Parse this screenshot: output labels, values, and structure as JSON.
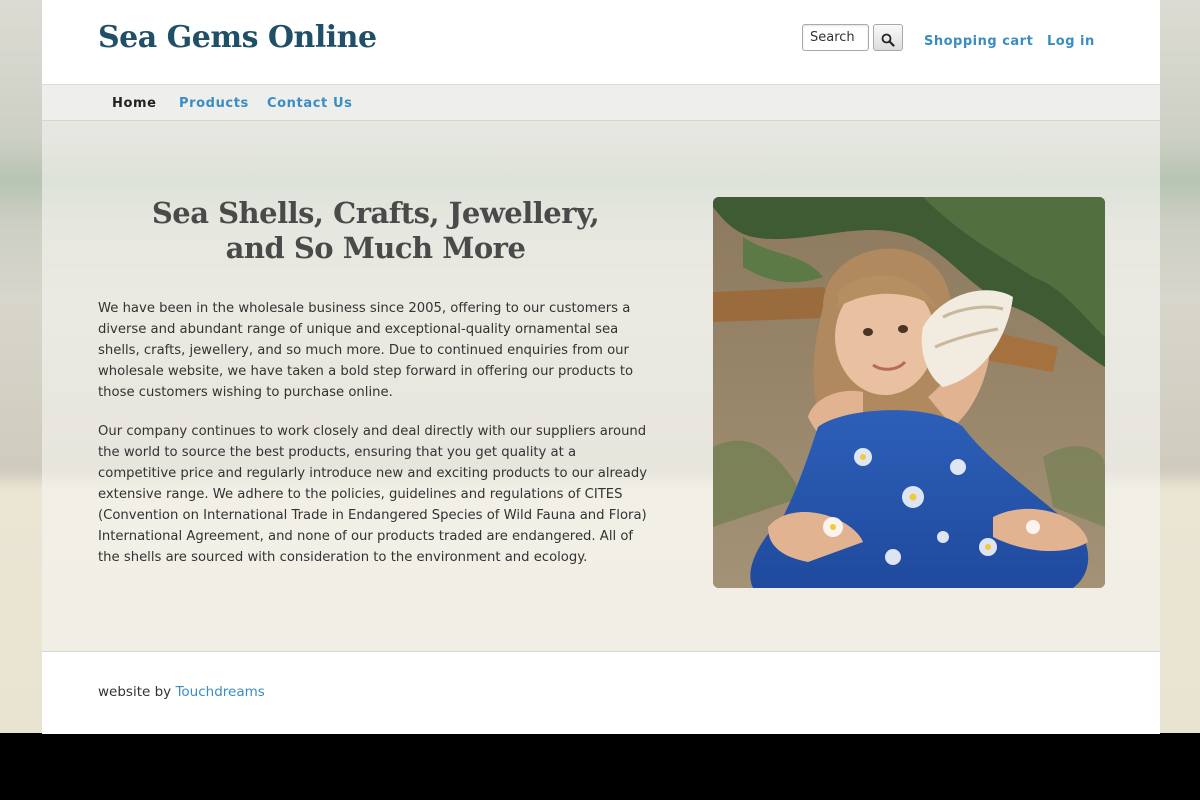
{
  "site": {
    "title": "Sea Gems Online"
  },
  "header": {
    "search_placeholder": "Search",
    "search_icon": "magnifier-icon",
    "links": {
      "cart": "Shopping cart",
      "login": "Log in"
    }
  },
  "nav": {
    "items": [
      {
        "label": "Home",
        "active": true
      },
      {
        "label": "Products",
        "active": false
      },
      {
        "label": "Contact Us",
        "active": false
      }
    ]
  },
  "main": {
    "heading_line1": "Sea Shells, Crafts, Jewellery,",
    "heading_line2": "and So Much More",
    "paragraph1": "We have been in the wholesale business since 2005, offering to our customers a diverse and abundant range of unique and exceptional-quality ornamental sea shells, crafts, jewellery, and so much more. Due to continued enquiries from our wholesale website, we have taken a bold step forward in offering our products to those customers wishing to purchase online.",
    "paragraph2": "Our company continues to work closely and deal directly with our suppliers around the world to source the best products, ensuring that you get quality at a competitive price and regularly introduce new and exciting products to our already extensive range. We adhere to the policies, guidelines and regulations of CITES (Convention on International Trade in Endangered Species of Wild Fauna and Flora) International Agreement, and none of our products traded are endangered. All of the shells are sourced with consideration to the environment and ecology."
  },
  "footer": {
    "credit_prefix": "website by",
    "credit_link": "Touchdreams"
  },
  "colors": {
    "brand": "#1f5067",
    "link": "#3a8dc4",
    "heading": "#4a4a4a"
  }
}
